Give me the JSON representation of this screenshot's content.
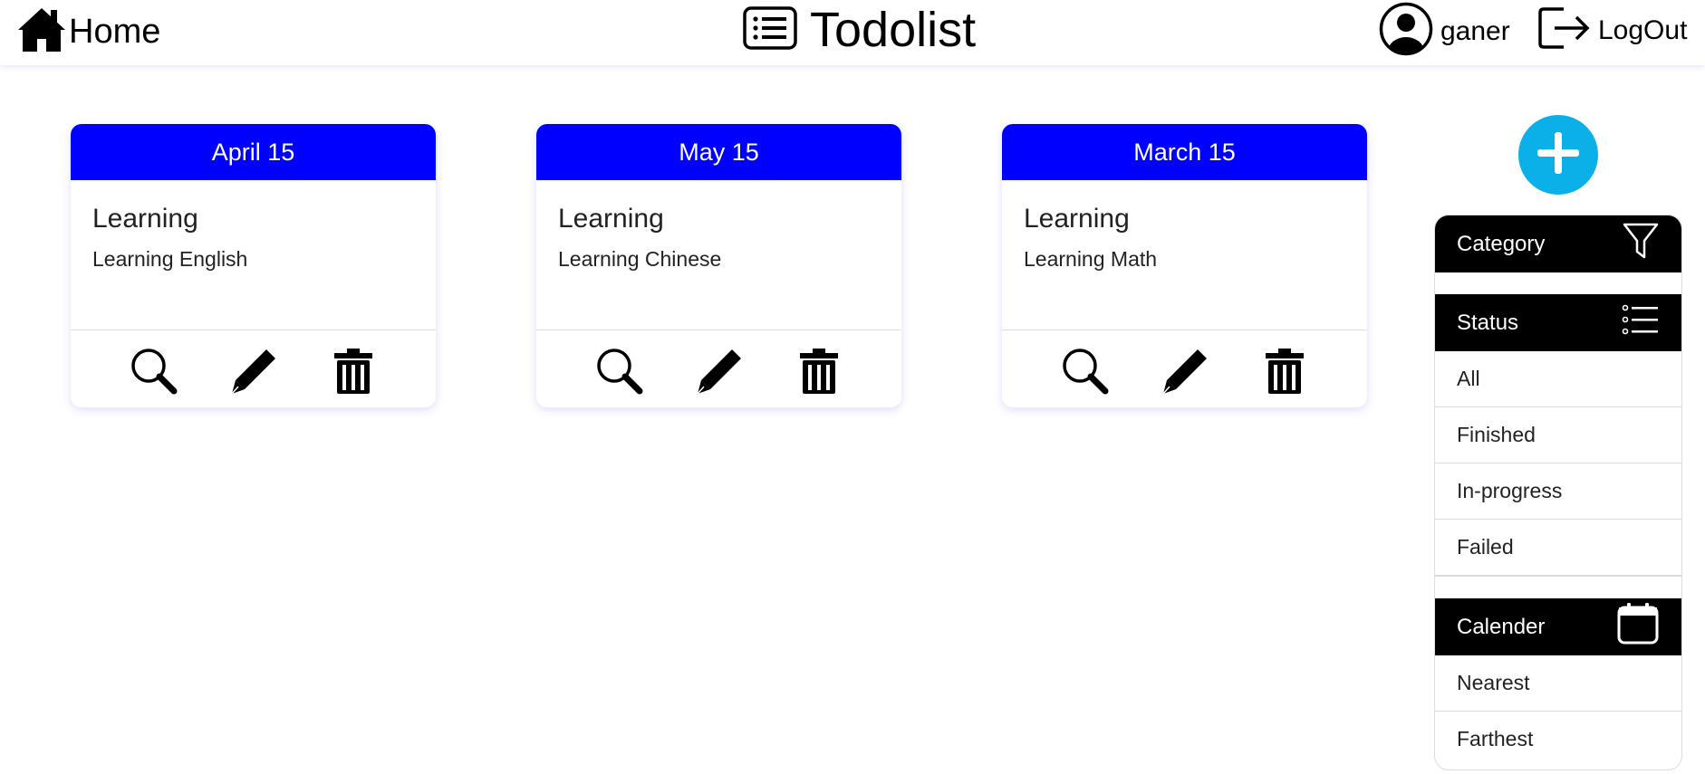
{
  "header": {
    "home_label": "Home",
    "brand_title": "Todolist",
    "username": "ganer",
    "logout_label": "LogOut"
  },
  "cards": [
    {
      "date": "April 15",
      "title": "Learning",
      "description": "Learning English"
    },
    {
      "date": "May 15",
      "title": "Learning",
      "description": "Learning Chinese"
    },
    {
      "date": "March 15",
      "title": "Learning",
      "description": "Learning Math"
    }
  ],
  "filters": {
    "category": {
      "label": "Category",
      "icon": "filter-icon"
    },
    "status": {
      "label": "Status",
      "icon": "list-icon",
      "options": [
        "All",
        "Finished",
        "In-progress",
        "Failed"
      ]
    },
    "calendar": {
      "label": "Calender",
      "icon": "calendar-icon",
      "options": [
        "Nearest",
        "Farthest"
      ]
    }
  },
  "colors": {
    "card_header": "#0000ff",
    "add_button": "#0bb0e8",
    "panel_header": "#000000"
  }
}
